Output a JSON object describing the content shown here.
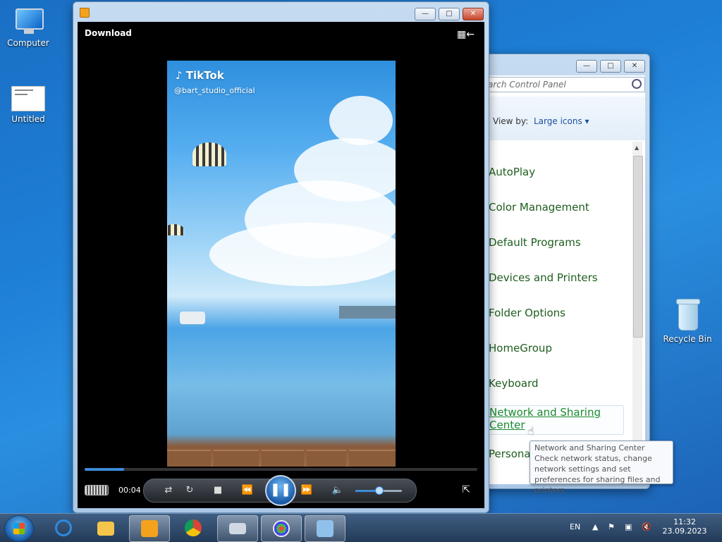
{
  "desktop": {
    "icons": [
      {
        "label": "Computer"
      },
      {
        "label": "Untitled"
      },
      {
        "label": "Recycle Bin"
      }
    ]
  },
  "control_panel": {
    "search_placeholder": "arch Control Panel",
    "view_by_label": "View by:",
    "view_by_value": "Large icons",
    "items": [
      "AutoPlay",
      "Color Management",
      "Default Programs",
      "Devices and Printers",
      "Folder Options",
      "HomeGroup",
      "Keyboard",
      "Network and Sharing Center",
      "Personalization"
    ],
    "hovered_item": "Network and Sharing Center",
    "tooltip": {
      "title": "Network and Sharing Center",
      "text": "Check network status, change network settings and set preferences for sharing files and printers."
    }
  },
  "media_player": {
    "overlay_label": "Download",
    "video": {
      "brand": "TikTok",
      "handle": "@bart_studio_official"
    },
    "time": "00:04",
    "progress": 0.1,
    "volume": 0.5
  },
  "taskbar": {
    "language": "EN",
    "time": "11:32",
    "date": "23.09.2023"
  }
}
